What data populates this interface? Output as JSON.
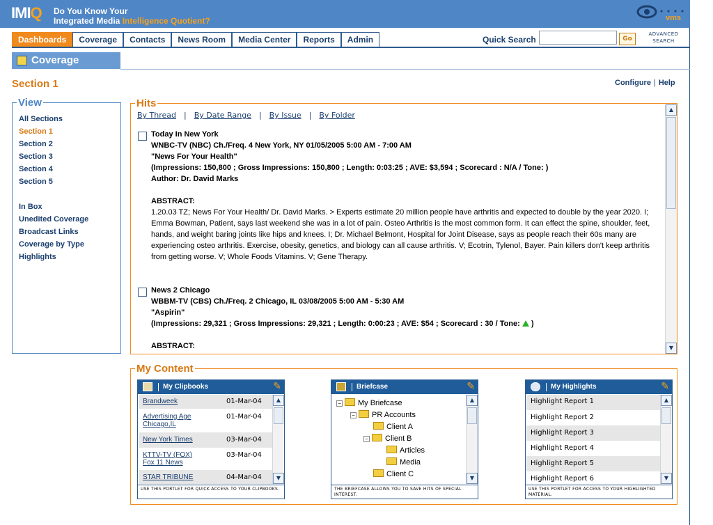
{
  "header": {
    "logo_main": "IMI",
    "logo_q": "Q",
    "tagline_line1": "Do You Know Your",
    "tagline_line2_a": "Integrated Media ",
    "tagline_line2_b": "Intelligence ",
    "tagline_line2_c": "Quotient?",
    "brand": "vms"
  },
  "nav": {
    "tabs": [
      "Dashboards",
      "Coverage",
      "Contacts",
      "News Room",
      "Media Center",
      "Reports",
      "Admin"
    ],
    "active": "Dashboards",
    "quick_search_label": "Quick Search",
    "quick_search_value": "",
    "go_label": "Go",
    "advanced_search": "ADVANCED SEARCH"
  },
  "page": {
    "title": "Coverage",
    "section": "Section 1",
    "configure": "Configure",
    "sep": "|",
    "help": "Help"
  },
  "view": {
    "legend": "View",
    "links": [
      "All Sections",
      "Section 1",
      "Section 2",
      "Section 3",
      "Section 4",
      "Section 5"
    ],
    "links2": [
      "In Box",
      "Unedited Coverage",
      "Broadcast Links",
      "Coverage by Type",
      "Highlights"
    ]
  },
  "hits": {
    "legend": "Hits",
    "filters": [
      "By Thread",
      "By Date Range",
      "By Issue",
      "By Folder"
    ],
    "items": [
      {
        "program": "Today In New York",
        "station": "WNBC-TV (NBC) Ch./Freq. 4   New York, NY   01/05/2005 5:00 AM - 7:00 AM",
        "headline": "\"News For Your Health\"",
        "metrics": "(Impressions: 150,800 ; Gross Impressions: 150,800 ; Length: 0:03:25 ; AVE: $3,594 ; Scorecard : N/A / Tone:     )",
        "author": "Author: Dr. David Marks",
        "abstract_label": "ABSTRACT:",
        "abstract": "1.20.03 TZ; News For Your Health/ Dr. David Marks. > Experts estimate 20 million people have arthritis and expected to double by the year 2020. I; Emma Bowman, Patient, says last weekend she was in a lot of pain. Osteo Arthritis is the most common form. It can effect the spine, shoulder, feet, hands, and weight baring joints like hips and knees. I; Dr. Michael Belmont, Hospital for Joint Disease, says as people reach their 60s many are experiencing osteo arthritis. Exercise, obesity, genetics, and biology can all cause arthritis. V; Ecotrin, Tylenol, Bayer. Pain killers don't keep arthritis from getting worse. V; Whole Foods Vitamins. V; Gene Therapy."
      },
      {
        "program": "News 2 Chicago",
        "station": "WBBM-TV (CBS) Ch./Freq. 2   Chicago, IL   03/08/2005 5:00 AM - 5:30 AM",
        "headline": "\"Aspirin\"",
        "metrics_a": "(Impressions: 29,321 ; Gross Impressions: 29,321 ; Length: 0:00:23 ; AVE: $54 ; Scorecard : 30 / Tone:",
        "metrics_b": ")",
        "abstract_label": "ABSTRACT:"
      }
    ]
  },
  "my_content": {
    "legend": "My Content",
    "clipbooks": {
      "title": "My Clipbooks",
      "rows": [
        {
          "name": "Brandweek",
          "date": "01-Mar-04"
        },
        {
          "name": "Advertising Age",
          "name2": "Chicago,IL",
          "date": "01-Mar-04"
        },
        {
          "name": "New York Times",
          "date": "03-Mar-04"
        },
        {
          "name": "KTTV-TV (FOX)",
          "name2": "Fox 11 News",
          "date": "03-Mar-04"
        },
        {
          "name": "STAR TRIBUNE",
          "date": "04-Mar-04"
        }
      ],
      "footer": "USE THIS PORTLET FOR QUICK ACCESS TO YOUR CLIPBOOKS."
    },
    "briefcase": {
      "title": "Briefcase",
      "tree": [
        "My Briefcase",
        "PR Accounts",
        "Client A",
        "Client B",
        "Articles",
        "Media",
        "Client C"
      ],
      "footer": "THE BRIEFCASE ALLOWS YOU TO SAVE HITS OF SPECIAL INTEREST."
    },
    "highlights": {
      "title": "My Highlights",
      "rows": [
        "Highlight Report 1",
        "Highlight Report 2",
        "Highlight Report 3",
        "Highlight Report 4",
        "Highlight Report 5",
        "Highlight Report 6"
      ],
      "footer": "USE THIS PORTLET FOR ACCESS TO YOUR HIGHLIGHTED MATERIAL."
    }
  },
  "colors": {
    "header_blue": "#4f86c6",
    "accent_orange": "#f08a1d",
    "nav_blue": "#1b3f6e",
    "tone_positive": "#2bb12b"
  }
}
